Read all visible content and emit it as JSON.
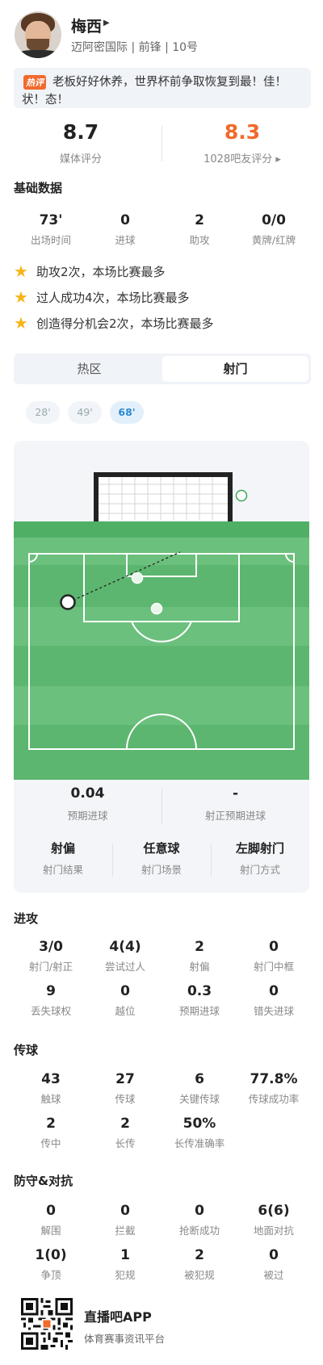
{
  "player": {
    "name": "梅西",
    "meta": "迈阿密国际 | 前锋 | 10号"
  },
  "hot": {
    "badge": "热评",
    "text": "老板好好休养，世界杯前争取恢复到最！佳！状！态！"
  },
  "ratings": {
    "media": {
      "value": "8.7",
      "label": "媒体评分"
    },
    "fans": {
      "value": "8.3",
      "label": "1028吧友评分 ▸"
    }
  },
  "basic": {
    "title": "基础数据",
    "items": [
      {
        "value": "73'",
        "label": "出场时间"
      },
      {
        "value": "0",
        "label": "进球"
      },
      {
        "value": "2",
        "label": "助攻"
      },
      {
        "value": "0/0",
        "label": "黄牌/红牌"
      }
    ]
  },
  "highlights": [
    "助攻2次，本场比赛最多",
    "过人成功4次，本场比赛最多",
    "创造得分机会2次，本场比赛最多"
  ],
  "tabs": [
    {
      "label": "热区",
      "active": false
    },
    {
      "label": "射门",
      "active": true
    }
  ],
  "minutes": [
    {
      "label": "28'",
      "active": false
    },
    {
      "label": "49'",
      "active": false
    },
    {
      "label": "68'",
      "active": true
    }
  ],
  "shot": {
    "xg": {
      "value": "0.04",
      "label": "预期进球"
    },
    "xgot": {
      "value": "-",
      "label": "射正预期进球"
    },
    "result": {
      "value": "射偏",
      "label": "射门结果"
    },
    "situation": {
      "value": "任意球",
      "label": "射门场景"
    },
    "body_part": {
      "value": "左脚射门",
      "label": "射门方式"
    }
  },
  "attack": {
    "title": "进攻",
    "items": [
      {
        "value": "3/0",
        "label": "射门/射正"
      },
      {
        "value": "4(4)",
        "label": "尝试过人"
      },
      {
        "value": "2",
        "label": "射偏"
      },
      {
        "value": "0",
        "label": "射门中框"
      },
      {
        "value": "9",
        "label": "丢失球权"
      },
      {
        "value": "0",
        "label": "越位"
      },
      {
        "value": "0.3",
        "label": "预期进球"
      },
      {
        "value": "0",
        "label": "错失进球"
      }
    ]
  },
  "passing": {
    "title": "传球",
    "items": [
      {
        "value": "43",
        "label": "触球"
      },
      {
        "value": "27",
        "label": "传球"
      },
      {
        "value": "6",
        "label": "关键传球"
      },
      {
        "value": "77.8%",
        "label": "传球成功率"
      },
      {
        "value": "2",
        "label": "传中"
      },
      {
        "value": "2",
        "label": "长传"
      },
      {
        "value": "50%",
        "label": "长传准确率"
      }
    ]
  },
  "defense": {
    "title": "防守&对抗",
    "items": [
      {
        "value": "0",
        "label": "解围"
      },
      {
        "value": "0",
        "label": "拦截"
      },
      {
        "value": "0",
        "label": "抢断成功"
      },
      {
        "value": "6(6)",
        "label": "地面对抗"
      },
      {
        "value": "1(0)",
        "label": "争顶"
      },
      {
        "value": "1",
        "label": "犯规"
      },
      {
        "value": "2",
        "label": "被犯规"
      },
      {
        "value": "0",
        "label": "被过"
      }
    ]
  },
  "footer": {
    "app_name": "直播吧APP",
    "app_desc": "体育赛事资讯平台"
  },
  "colors": {
    "media_rating": "#222222",
    "fans_rating": "#f06a2a",
    "pitch_light": "#6cc07d",
    "pitch_dark": "#5cb66f",
    "star": "#f6b619"
  }
}
